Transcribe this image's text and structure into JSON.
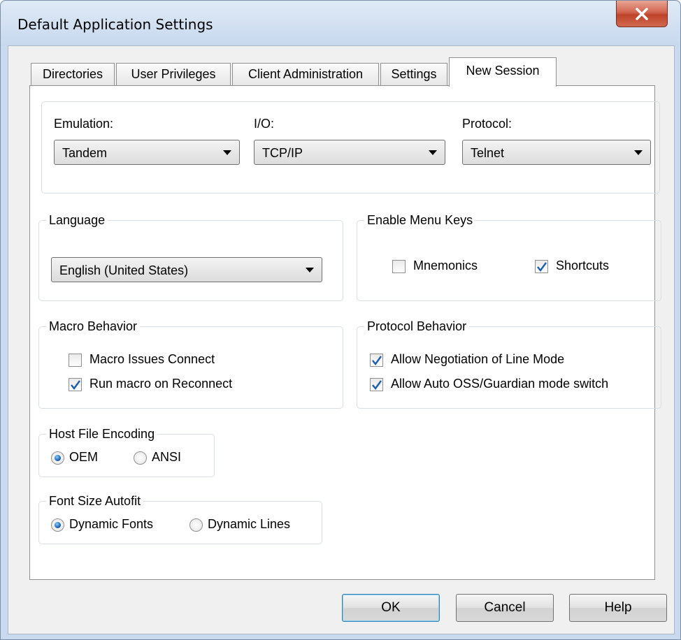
{
  "window": {
    "title": "Default Application Settings",
    "close_label": "X"
  },
  "tabs": [
    {
      "label": "Directories",
      "active": false
    },
    {
      "label": "User Privileges",
      "active": false
    },
    {
      "label": "Client Administration",
      "active": false
    },
    {
      "label": "Settings",
      "active": false
    },
    {
      "label": "New Session",
      "active": true
    }
  ],
  "connection": {
    "emulation": {
      "label": "Emulation:",
      "value": "Tandem"
    },
    "io": {
      "label": "I/O:",
      "value": "TCP/IP"
    },
    "protocol": {
      "label": "Protocol:",
      "value": "Telnet"
    }
  },
  "language": {
    "title": "Language",
    "value": "English (United States)"
  },
  "menu_keys": {
    "title": "Enable Menu Keys",
    "mnemonics": {
      "label": "Mnemonics",
      "checked": false
    },
    "shortcuts": {
      "label": "Shortcuts",
      "checked": true
    }
  },
  "macro_behavior": {
    "title": "Macro Behavior",
    "issues_connect": {
      "label": "Macro Issues Connect",
      "checked": false
    },
    "run_on_reconnect": {
      "label": "Run macro on Reconnect",
      "checked": true
    }
  },
  "protocol_behavior": {
    "title": "Protocol Behavior",
    "line_mode": {
      "label": "Allow Negotiation of Line Mode",
      "checked": true
    },
    "oss_switch": {
      "label": "Allow Auto OSS/Guardian mode switch",
      "checked": true
    }
  },
  "host_file_encoding": {
    "title": "Host File Encoding",
    "options": [
      "OEM",
      "ANSI"
    ],
    "selected": "OEM"
  },
  "font_size_autofit": {
    "title": "Font Size Autofit",
    "options": [
      "Dynamic Fonts",
      "Dynamic Lines"
    ],
    "selected": "Dynamic Fonts"
  },
  "buttons": {
    "ok": "OK",
    "cancel": "Cancel",
    "help": "Help"
  },
  "colors": {
    "titlebar": "#c7d8ee",
    "close": "#c0432b",
    "panel": "#ffffff",
    "dialog": "#f0f0f0",
    "check": "#1b5fb0"
  }
}
